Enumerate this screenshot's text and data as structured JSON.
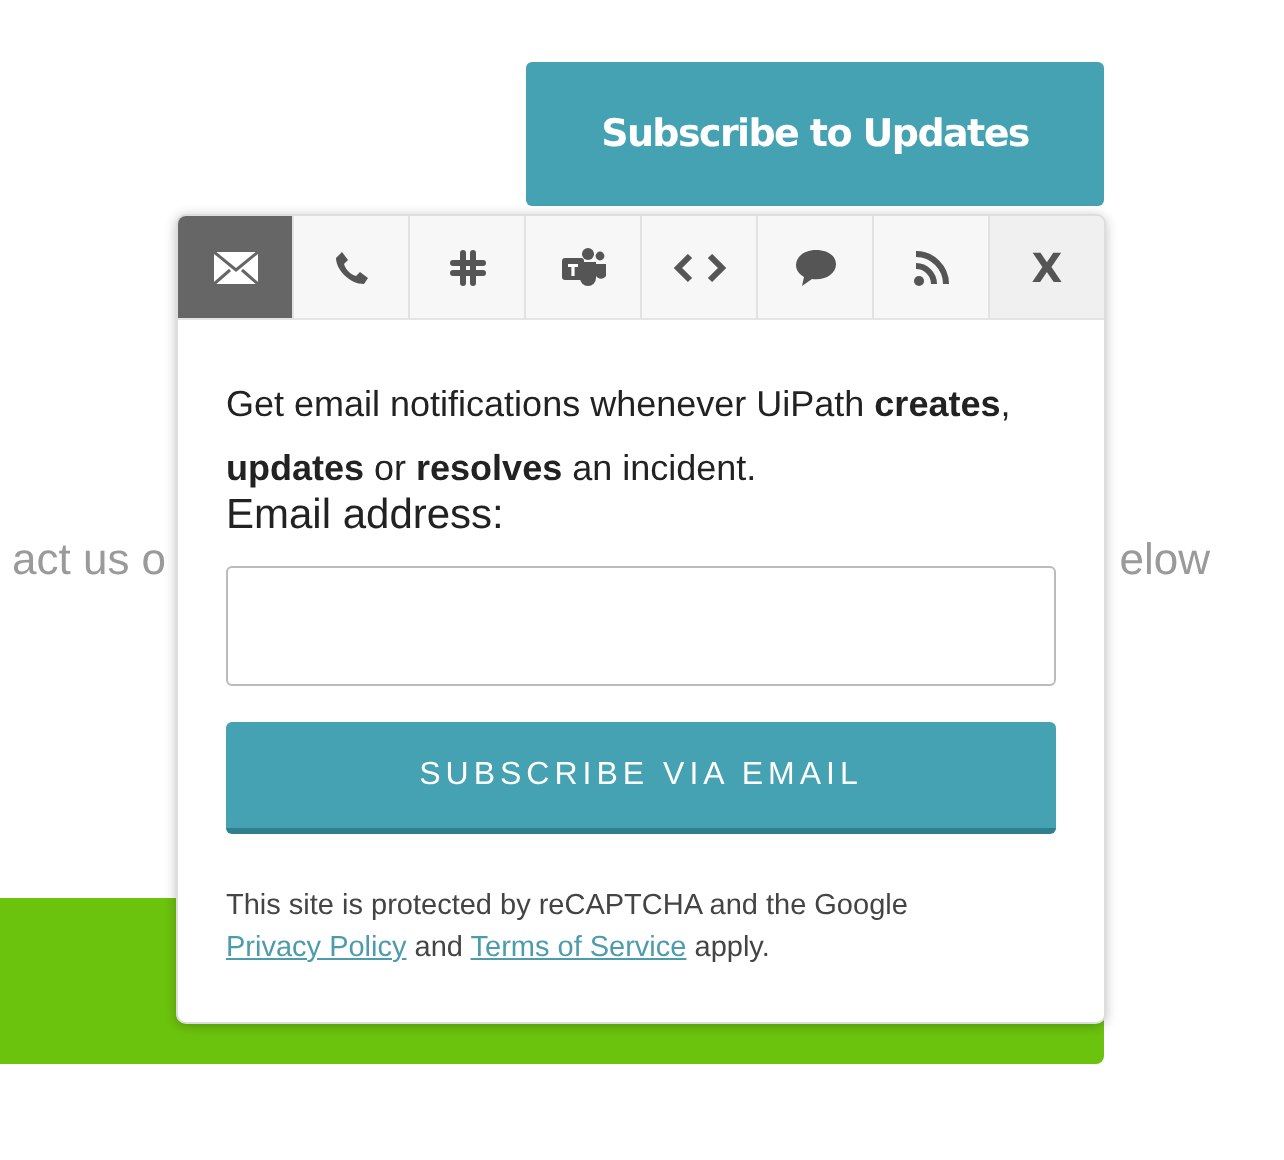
{
  "header": {
    "subscribe_button": "Subscribe to Updates"
  },
  "background": {
    "text_left": "act us o",
    "text_right": "elow"
  },
  "popup": {
    "tabs": [
      {
        "kind": "email",
        "selected": true
      },
      {
        "kind": "phone",
        "selected": false
      },
      {
        "kind": "slack",
        "selected": false
      },
      {
        "kind": "teams",
        "selected": false
      },
      {
        "kind": "webhook",
        "selected": false
      },
      {
        "kind": "chat",
        "selected": false
      },
      {
        "kind": "rss",
        "selected": false
      },
      {
        "kind": "close",
        "label": "X",
        "selected": false
      }
    ],
    "intro": "Get email notifications whenever UiPath **creates**, **updates** or **resolves** an incident.",
    "field_label": "Email address:",
    "submit_button": "SUBSCRIBE VIA EMAIL",
    "notice": {
      "before": "This site is protected by reCAPTCHA and the Google",
      "privacy_link": "Privacy Policy",
      "middle": "and",
      "terms_link": "Terms of Service",
      "after": "apply."
    }
  }
}
